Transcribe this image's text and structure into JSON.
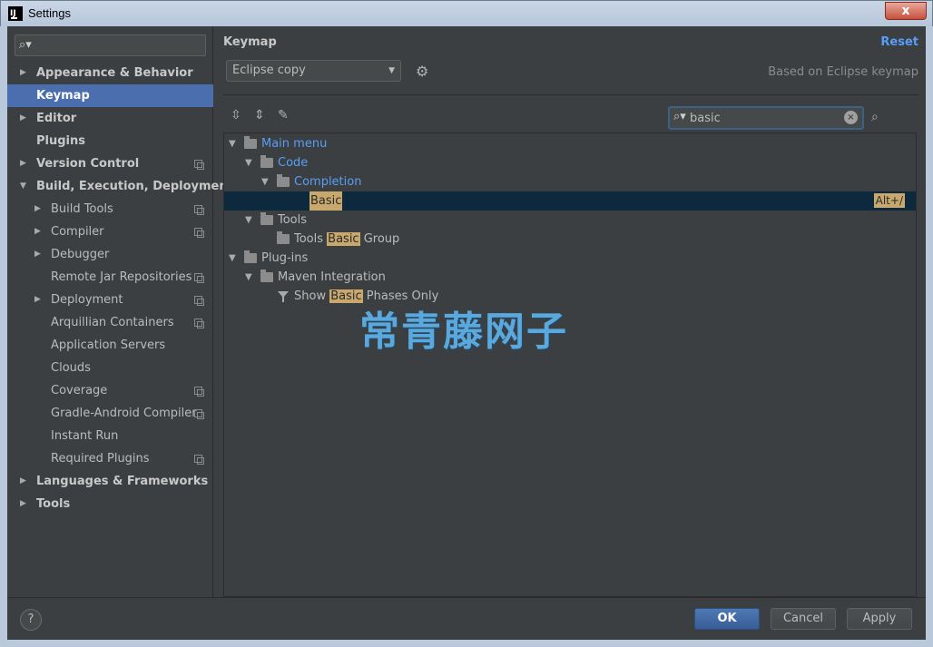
{
  "window": {
    "title": "Settings",
    "close_label": "x"
  },
  "sidebar": {
    "search_placeholder": "",
    "items": [
      {
        "label": "Appearance & Behavior",
        "arrow": "▶"
      },
      {
        "label": "Keymap"
      },
      {
        "label": "Editor",
        "arrow": "▶"
      },
      {
        "label": "Plugins"
      },
      {
        "label": "Version Control",
        "arrow": "▶"
      },
      {
        "label": "Build, Execution, Deployment",
        "arrow": "▼"
      },
      {
        "label": "Build Tools",
        "arrow": "▶"
      },
      {
        "label": "Compiler",
        "arrow": "▶"
      },
      {
        "label": "Debugger",
        "arrow": "▶"
      },
      {
        "label": "Remote Jar Repositories"
      },
      {
        "label": "Deployment",
        "arrow": "▶"
      },
      {
        "label": "Arquillian Containers"
      },
      {
        "label": "Application Servers"
      },
      {
        "label": "Clouds"
      },
      {
        "label": "Coverage"
      },
      {
        "label": "Gradle-Android Compiler"
      },
      {
        "label": "Instant Run"
      },
      {
        "label": "Required Plugins"
      },
      {
        "label": "Languages & Frameworks",
        "arrow": "▶"
      },
      {
        "label": "Tools",
        "arrow": "▶"
      }
    ]
  },
  "main": {
    "title": "Keymap",
    "reset_label": "Reset",
    "keymap_value": "Eclipse copy",
    "based_on": "Based on Eclipse keymap",
    "filter_value": "basic",
    "tree": {
      "main_menu": "Main menu",
      "code": "Code",
      "completion": "Completion",
      "basic": "Basic",
      "basic_shortcut": "Alt+/",
      "tools": "Tools",
      "tools_group_prefix": "Tools ",
      "tools_group_match": "Basic",
      "tools_group_suffix": " Group",
      "plugins": "Plug-ins",
      "maven": "Maven Integration",
      "show_prefix": "Show ",
      "show_match": "Basic",
      "show_suffix": " Phases Only"
    }
  },
  "watermark": "常青藤网子",
  "footer": {
    "help_label": "?",
    "ok_label": "OK",
    "cancel_label": "Cancel",
    "apply_label": "Apply"
  },
  "icons": {
    "search": "search-icon",
    "gear": "gear-icon",
    "expand_all": "expand-all-icon",
    "collapse_all": "collapse-all-icon",
    "edit": "edit-icon",
    "find_shortcut": "find-by-shortcut-icon"
  },
  "colors": {
    "selection": "#4b6eaf",
    "link": "#589df6",
    "highlight": "#c9a86d"
  }
}
